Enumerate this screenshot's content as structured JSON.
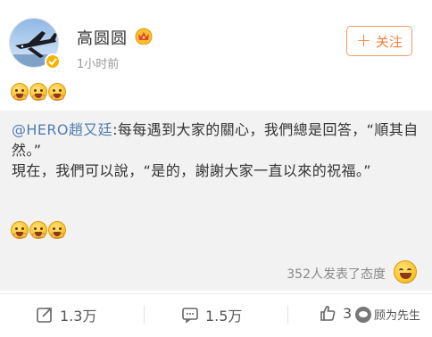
{
  "post": {
    "username": "高圆圆",
    "timestamp": "1小时前",
    "follow_label": "关注",
    "follow_plus": "+"
  },
  "retweet": {
    "mention": "@HERO趙又廷",
    "text": ":每每遇到大家的關心，我們總是回答，“順其自然。”\n現在，我們可以說，“是的，謝謝大家一直以來的祝福。”"
  },
  "reactions": {
    "text": "352人发表了态度"
  },
  "actions": {
    "share_count": "1.3万",
    "comment_count": "1.5万",
    "like_count": "3"
  },
  "watermark": {
    "text": "顾为先生"
  },
  "icons": {
    "avatar": "airplane-avatar",
    "badge": "verified-badge",
    "crown": "crown-icon",
    "emoji": "pray-emoji",
    "reaction": "grin-emoji",
    "share": "share-icon",
    "comment": "comment-icon",
    "like": "like-icon"
  },
  "colors": {
    "accent": "#f08040",
    "mention": "#507daf",
    "retweet_bg": "#f2f2f2",
    "muted": "#999999"
  }
}
